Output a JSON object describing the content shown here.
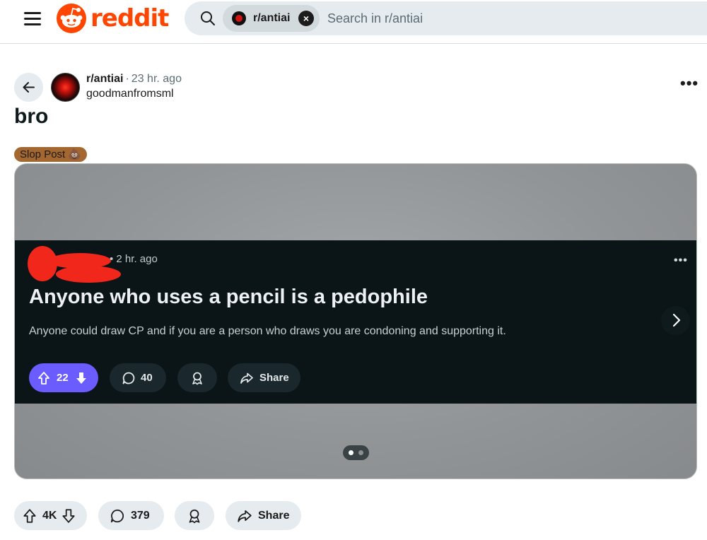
{
  "header": {
    "logo_text": "reddit",
    "search": {
      "chip_label": "r/antiai",
      "placeholder": "Search in r/antiai"
    }
  },
  "post": {
    "subreddit": "r/antiai",
    "time": "23 hr. ago",
    "author": "goodmanfromsml",
    "title": "bro",
    "flair": "Slop Post 💩",
    "embedded": {
      "time": "• 2 hr. ago",
      "title": "Anyone who uses a pencil is a pedophile",
      "body": "Anyone could draw CP and if you are a person who draws you are condoning and supporting it.",
      "votes": "22",
      "comments": "40",
      "share": "Share"
    },
    "gallery": {
      "current": 1,
      "total": 2
    },
    "actions": {
      "votes": "4K",
      "comments": "379",
      "share": "Share"
    }
  },
  "colors": {
    "brand": "#ff4500",
    "flair_bg": "#a4672f",
    "vote_pill": "#6a5cff",
    "redaction": "#f0271a"
  }
}
